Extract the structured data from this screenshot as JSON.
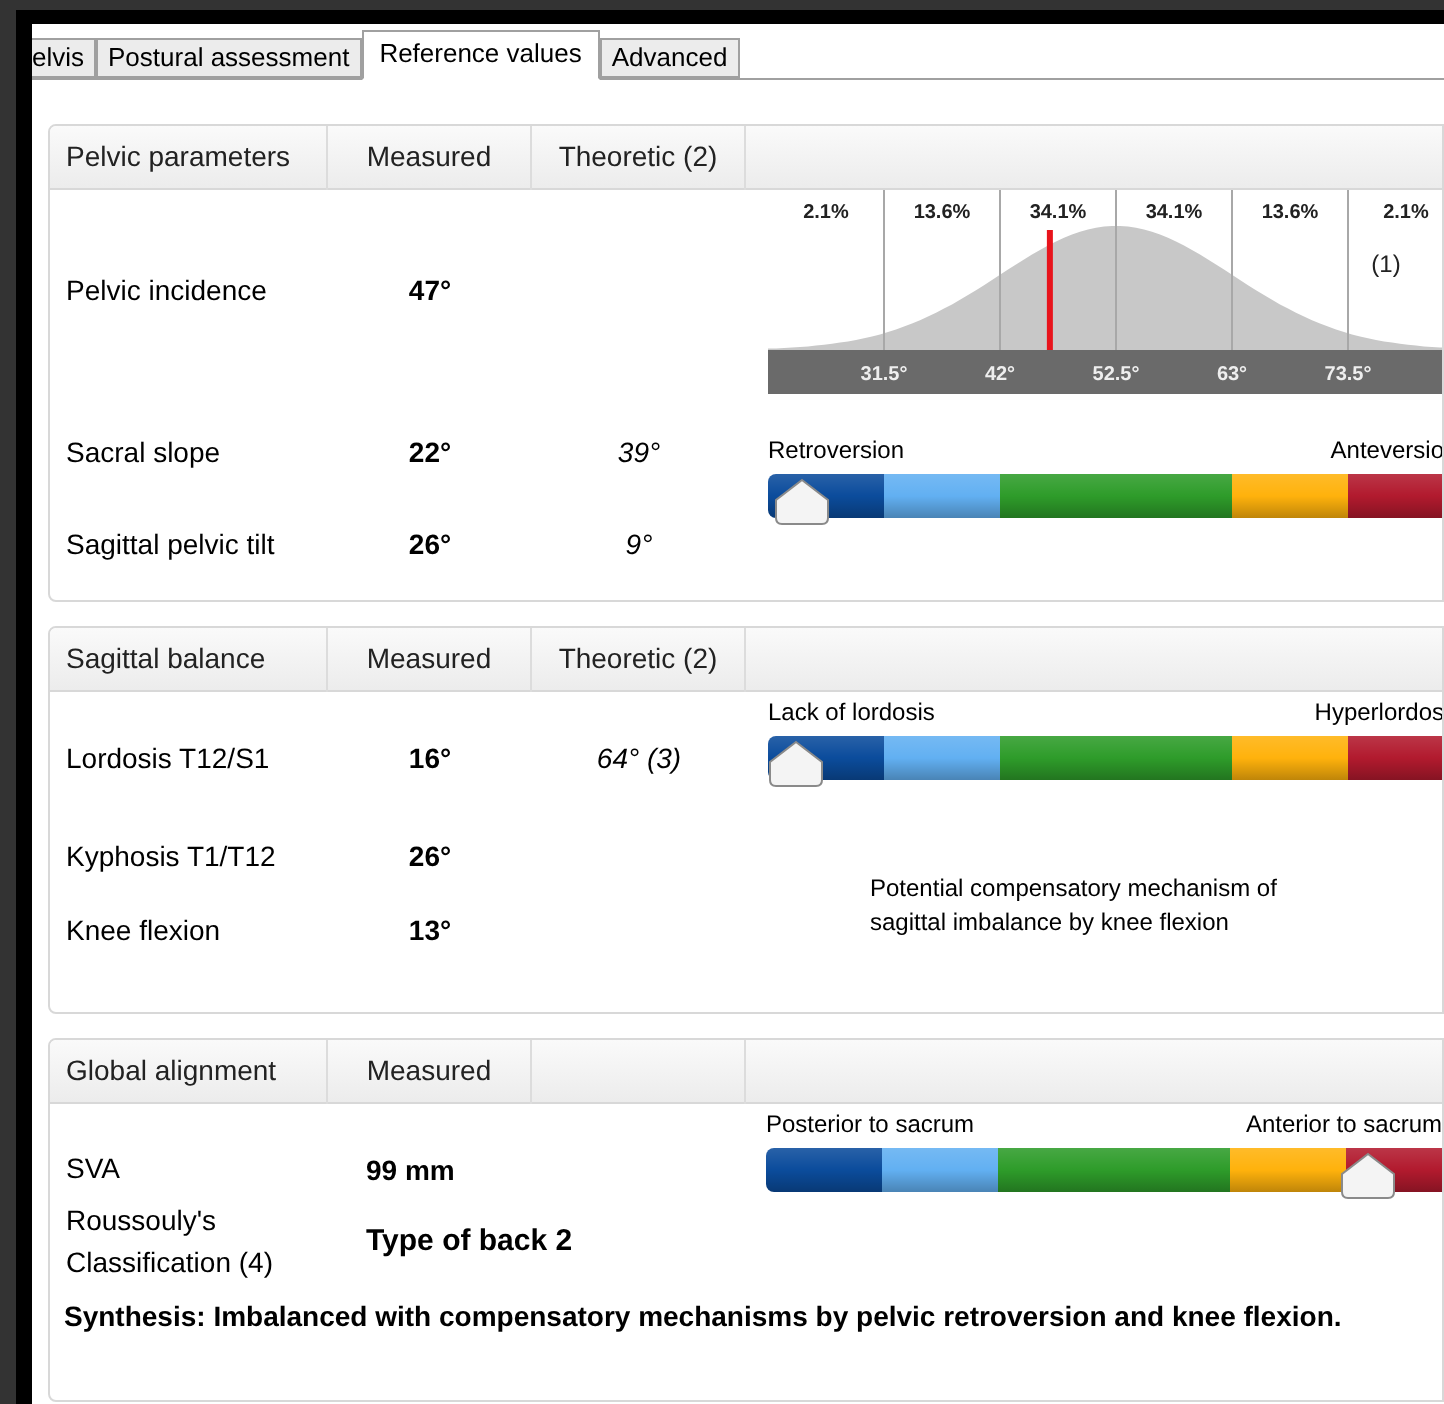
{
  "tabs": [
    {
      "label": "elvis",
      "selected": false
    },
    {
      "label": "Postural assessment",
      "selected": false
    },
    {
      "label": "Reference values",
      "selected": true
    },
    {
      "label": "Advanced",
      "selected": false
    }
  ],
  "pelvic": {
    "headers": [
      "Pelvic parameters",
      "Measured",
      "Theoretic (2)"
    ],
    "rows": [
      {
        "name": "Pelvic incidence",
        "measured": "47°"
      },
      {
        "name": "Sacral slope",
        "measured": "22°",
        "theoretic": "39°"
      },
      {
        "name": "Sagittal pelvic tilt",
        "measured": "26°",
        "theoretic": "9°"
      }
    ],
    "distribution": {
      "bands": [
        "2.1%",
        "13.6%",
        "34.1%",
        "34.1%",
        "13.6%",
        "2.1%"
      ],
      "ticks": [
        "31.5°",
        "42°",
        "52.5°",
        "63°",
        "73.5°"
      ],
      "note": "(1)",
      "level": 0.405
    },
    "gauge": {
      "left": "Retroversion",
      "right": "Anteversio",
      "level": 0.05
    }
  },
  "sagittal": {
    "headers": [
      "Sagittal balance",
      "Measured",
      "Theoretic (2)"
    ],
    "rows": [
      {
        "name": "Lordosis T12/S1",
        "measured": "16°",
        "theoretic": "64° (3)"
      },
      {
        "name": "Kyphosis T1/T12",
        "measured": "26°"
      },
      {
        "name": "Knee flexion",
        "measured": "13°"
      }
    ],
    "gauge": {
      "left": "Lack of lordosis",
      "right": "Hyperlordos",
      "level": 0.04
    },
    "note": "Potential compensatory mechanism of sagittal imbalance by knee flexion"
  },
  "global": {
    "headers": [
      "Global alignment",
      "Measured"
    ],
    "rows": [
      {
        "name": "SVA",
        "measured": "99 mm"
      },
      {
        "name": "Roussouly's Classification (4)",
        "measured": "Type of back 2"
      }
    ],
    "gauge": {
      "left": "Posterior to sacrum",
      "right": "Anterior to sacrum",
      "level": 0.865
    },
    "synthesis": "Synthesis: Imbalanced with compensatory mechanisms by pelvic retroversion and knee flexion."
  }
}
